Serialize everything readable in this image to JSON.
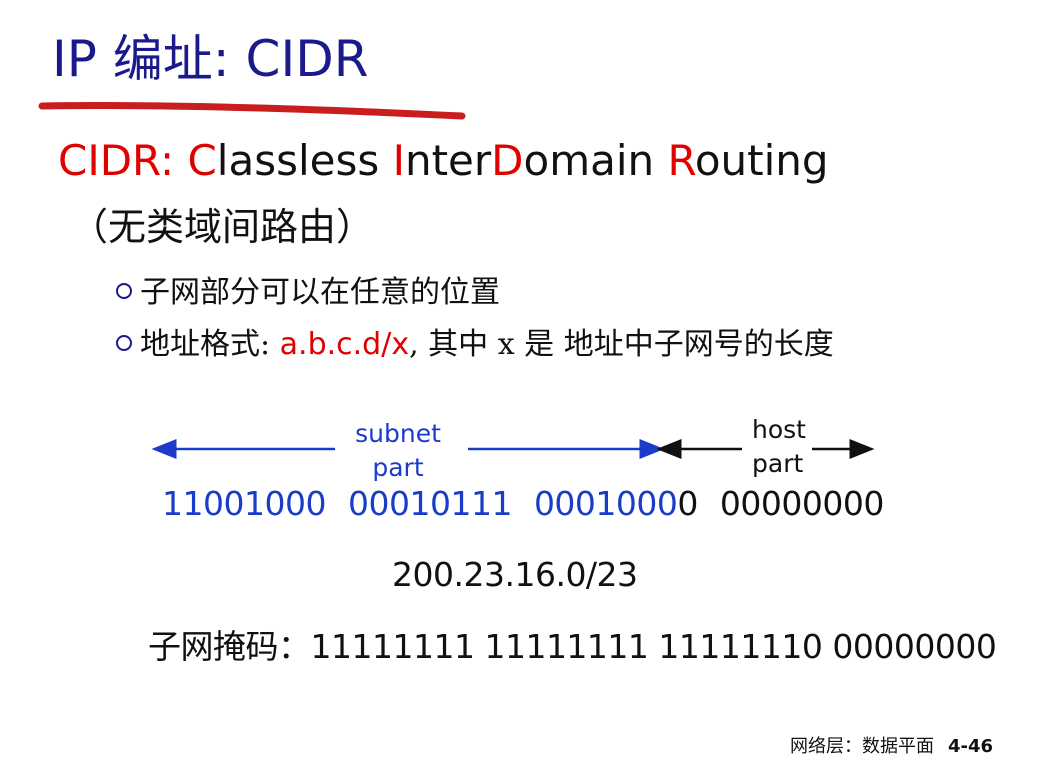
{
  "slide": {
    "title": "IP 编址: CIDR",
    "cidr_line": {
      "prefix": "CIDR: ",
      "c": "C",
      "lassless": "lassless ",
      "i": "I",
      "nter": "nter",
      "d": "D",
      "omain": "omain ",
      "r": "R",
      "outing": "outing"
    },
    "chinese_expansion": "（无类域间路由）",
    "bullets": [
      {
        "text": "子网部分可以在任意的位置"
      },
      {
        "prefix": "地址格式: ",
        "format": "a.b.c.d/x",
        "suffix": ", 其中 x 是 地址中子网号的长度"
      }
    ],
    "diagram": {
      "subnet_label_1": "subnet",
      "subnet_label_2": "part",
      "host_label_1": "host",
      "host_label_2": "part",
      "binary": {
        "octet1": "11001000",
        "octet2": "00010111",
        "octet3_subnet": "0001000",
        "octet3_host": "0",
        "octet4": "00000000"
      },
      "network_address": "200.23.16.0/23",
      "mask_label": "子网掩码：",
      "mask_value": "11111111 11111111 11111110 00000000"
    },
    "footer": {
      "section": "网络层：数据平面",
      "page": "4-46"
    },
    "colors": {
      "title": "#1a1a8c",
      "accent_red": "#e00000",
      "subnet_blue": "#1a3cc8",
      "underline": "#c81e1e"
    }
  }
}
